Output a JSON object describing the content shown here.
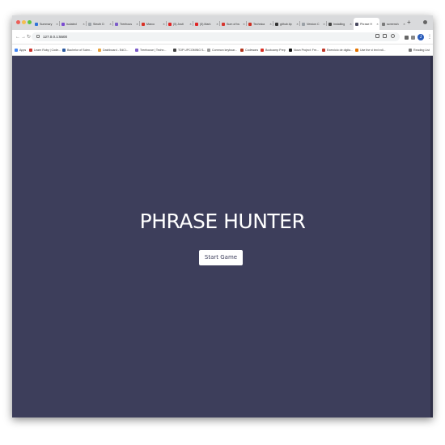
{
  "browser": {
    "tabs": [
      {
        "title": "Summary",
        "fav": "#2f73d9"
      },
      {
        "title": "Isolated",
        "fav": "#7b4bd1"
      },
      {
        "title": "Sleuth D",
        "fav": "#9ea3a8"
      },
      {
        "title": "Treehous",
        "fav": "#7c5cc9"
      },
      {
        "title": "Marco",
        "fav": "#d93025"
      },
      {
        "title": "(5) Justi",
        "fav": "#e02424"
      },
      {
        "title": "(5) Mark",
        "fav": "#e02424"
      },
      {
        "title": "Sum of tw",
        "fav": "#d6352d"
      },
      {
        "title": "Technica",
        "fav": "#cc2f22"
      },
      {
        "title": "github.tip",
        "fav": "#333333"
      },
      {
        "title": "Version C",
        "fav": "#9aa0a6"
      },
      {
        "title": "Installing",
        "fav": "#444444"
      },
      {
        "title": "Phrase H",
        "fav": "#4a4a60"
      },
      {
        "title": "screensh",
        "fav": "#7a7a7a"
      }
    ],
    "active_tab_index": 12,
    "new_tab": "+",
    "url": "127.0.0.1:5500",
    "profile_initial": "J",
    "bookmarks": [
      {
        "label": "Apps",
        "fav": "#4285f4"
      },
      {
        "label": "Learn Ruby | Code...",
        "fav": "#cc342d"
      },
      {
        "label": "Bachelor of Scien...",
        "fav": "#2c5aa0"
      },
      {
        "label": "Dashboard - EdCl...",
        "fav": "#e8a33d"
      },
      {
        "label": "Treehouse | Techn...",
        "fav": "#7c5cc9"
      },
      {
        "label": "TOP UPCOMING S...",
        "fav": "#444444"
      },
      {
        "label": "Common keyboar...",
        "fav": "#999999"
      },
      {
        "label": "Codewars",
        "fav": "#b1361e"
      },
      {
        "label": "Bootcamp Prep",
        "fav": "#d93025"
      },
      {
        "label": "Noun Project: Fre...",
        "fav": "#111111"
      },
      {
        "label": "Exercicio de digita...",
        "fav": "#c0392b"
      },
      {
        "label": "Use the vi text edi...",
        "fav": "#e37400"
      }
    ],
    "reading_list": "Reading List"
  },
  "page": {
    "headline": "PHRASE HUNTER",
    "start_button": "Start Game"
  },
  "colors": {
    "background": "#3d3e5b",
    "button_bg": "#ffffff"
  }
}
